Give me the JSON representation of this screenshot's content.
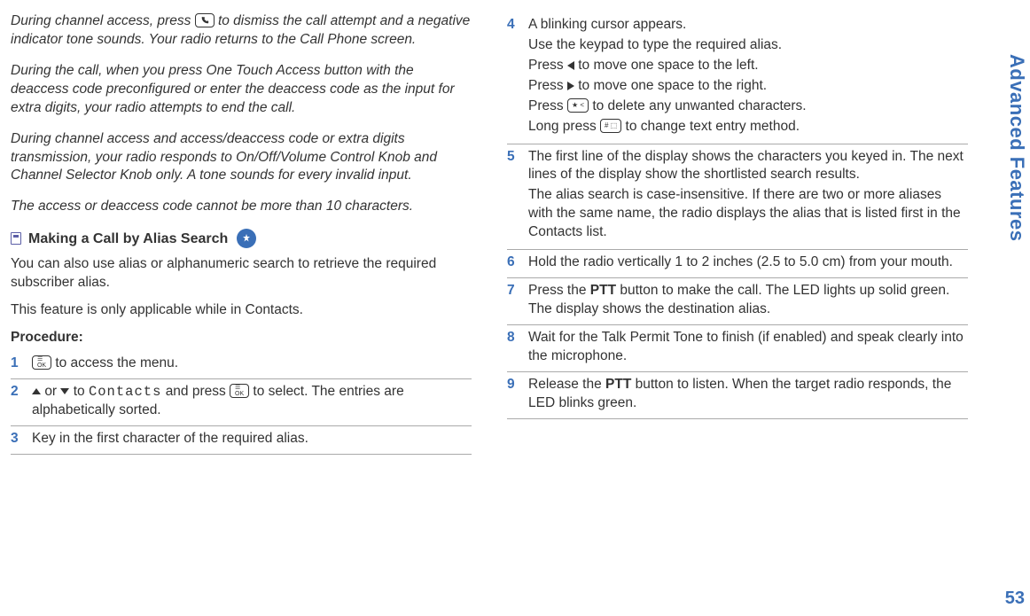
{
  "sideTab": "Advanced Features",
  "pageNumber": "53",
  "left": {
    "p1": "During channel access, press ",
    "p1b": "to dismiss the call attempt and a negative indicator tone sounds. Your radio returns to the Call Phone screen.",
    "p2": "During the call, when you press One Touch Access button with the deaccess code preconfigured or enter the deaccess code as the input for extra digits, your radio attempts to end the call.",
    "p3": "During channel access and access/deaccess code or extra digits transmission, your radio responds to On/Off/Volume Control Knob and Channel Selector Knob only. A tone sounds for every invalid input.",
    "p4": "The access or deaccess code cannot be more than 10 characters.",
    "subhead": "Making a Call by Alias Search",
    "intro1": "You can also use alias or alphanumeric search to retrieve the required subscriber alias.",
    "intro2": "This feature is only applicable while in Contacts.",
    "procLabel": "Procedure:",
    "step1": " to access the menu.",
    "step2a": " or ",
    "step2b": " to ",
    "step2contacts": "Contacts",
    "step2c": " and press ",
    "step2d": " to select. The entries are alphabetically sorted.",
    "step3": "Key in the first character of the required alias."
  },
  "right": {
    "s4l1": "A blinking cursor appears.",
    "s4l2": "Use the keypad to type the required alias.",
    "s4l3a": "Press ",
    "s4l3b": " to move one space to the left.",
    "s4l4a": "Press ",
    "s4l4b": " to move one space to the right.",
    "s4l5a": "Press ",
    "s4l5b": " to delete any unwanted characters.",
    "s4l6a": "Long press ",
    "s4l6b": " to change text entry method.",
    "s5l1": "The first line of the display shows the characters you keyed in. The next lines of the display show the shortlisted search results.",
    "s5l2": "The alias search is case-insensitive. If there are two or more aliases with the same name, the radio displays the alias that is listed first in the Contacts list.",
    "s6": "Hold the radio vertically 1 to 2 inches (2.5 to 5.0 cm) from your mouth.",
    "s7a": "Press the ",
    "s7ptt": "PTT",
    "s7b": " button to make the call. The LED lights up solid green. The display shows the destination alias.",
    "s8": "Wait for the Talk Permit Tone to finish (if enabled) and speak clearly into the microphone.",
    "s9a": "Release the ",
    "s9ptt": "PTT",
    "s9b": " button to listen. When the target radio responds, the LED blinks green."
  },
  "stepNums": {
    "n1": "1",
    "n2": "2",
    "n3": "3",
    "n4": "4",
    "n5": "5",
    "n6": "6",
    "n7": "7",
    "n8": "8",
    "n9": "9"
  },
  "keys": {
    "ok": "OK",
    "star": "★  <",
    "hash": "#  ⬚",
    "phone": "⌕"
  }
}
